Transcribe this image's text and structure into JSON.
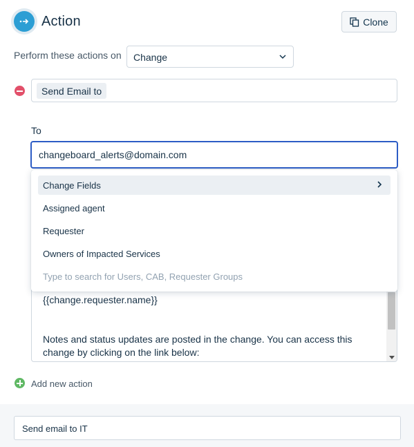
{
  "header": {
    "title": "Action",
    "clone_label": "Clone",
    "icon": "arrow-right-icon"
  },
  "perform": {
    "label": "Perform these actions on",
    "selected": "Change"
  },
  "action": {
    "type_label": "Send Email to"
  },
  "to": {
    "label": "To",
    "value": "changeboard_alerts@domain.com"
  },
  "dropdown": {
    "items": [
      {
        "label": "Change Fields",
        "has_submenu": true
      },
      {
        "label": "Assigned agent"
      },
      {
        "label": "Requester"
      },
      {
        "label": "Owners of Impacted Services"
      }
    ],
    "hint": "Type to search for Users, CAB, Requester Groups"
  },
  "body": {
    "line1": "{{change.requester.name}}",
    "line2": "Notes and status updates are posted in the change. You can access this",
    "line3": "change by clicking on the link below:"
  },
  "add_action_label": "Add new action",
  "footer": {
    "name_value": "Send email to IT"
  },
  "colors": {
    "accent": "#2c9ed4",
    "focus": "#2c5cc5",
    "remove": "#e2506a",
    "add": "#5fb864"
  }
}
